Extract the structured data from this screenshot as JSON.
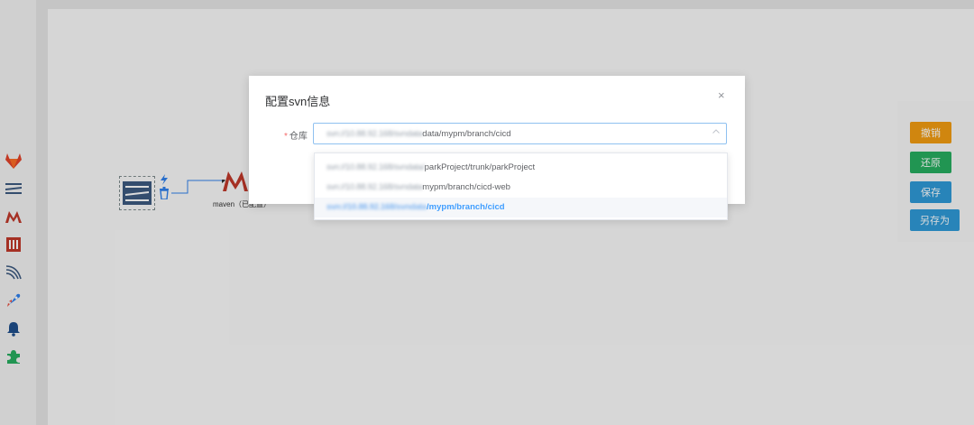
{
  "dialog": {
    "title": "配置svn信息",
    "close_glyph": "×",
    "field_label": "仓库",
    "required_mark": "*",
    "select": {
      "value_blurred": "svn://10.88.92.168/svndata",
      "value_visible": "data/mypm/branch/cicd"
    },
    "options": [
      {
        "blurred": "svn://10.88.92.168/svndata/",
        "visible": "parkProject/trunk/parkProject",
        "selected": false
      },
      {
        "blurred": "svn://10.88.92.168/svndata",
        "visible": "mypm/branch/cicd-web",
        "selected": false
      },
      {
        "blurred": "svn://10.88.92.168/svndata",
        "visible": "/mypm/branch/cicd",
        "selected": true
      }
    ]
  },
  "right_panel": {
    "cancel": "撤销",
    "restore": "还原",
    "save": "保存",
    "save_as": "另存为"
  },
  "canvas": {
    "maven_label": "maven（已配置）"
  },
  "colors": {
    "accent": "#409eff",
    "cancel": "#f39c12",
    "restore": "#27ae60",
    "save": "#2f9ad8",
    "required": "#f56c6c"
  },
  "icons": [
    "gitlab-icon",
    "svn-icon",
    "maven-icon",
    "build-icon",
    "deploy-icon",
    "rocket-icon",
    "bell-icon",
    "plugin-icon"
  ]
}
